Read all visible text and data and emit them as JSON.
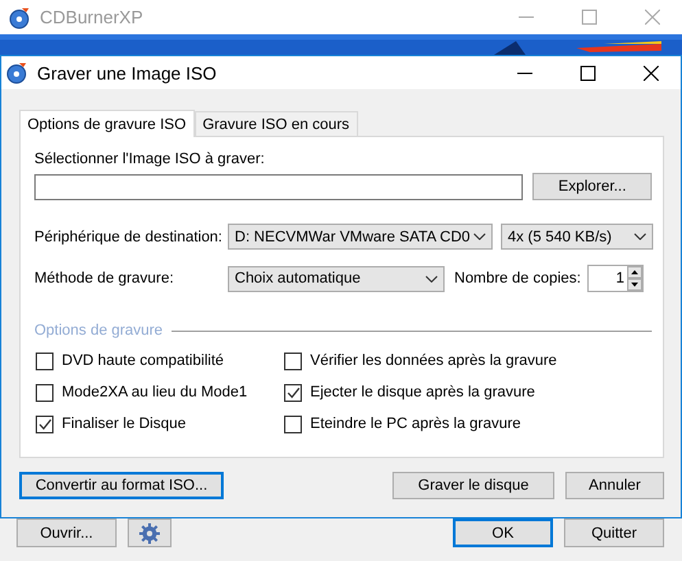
{
  "background_window": {
    "title": "CDBurnerXP",
    "buttons": [
      {
        "kind": "text",
        "label": "Ouvrir...",
        "default": false
      },
      {
        "kind": "settings"
      },
      {
        "kind": "text",
        "label": "OK",
        "default": true
      },
      {
        "kind": "text",
        "label": "Quitter",
        "default": false
      }
    ]
  },
  "dialog": {
    "title": "Graver une Image ISO",
    "tabs": [
      {
        "label": "Options de gravure ISO",
        "selected": true
      },
      {
        "label": "Gravure ISO en cours",
        "selected": false
      }
    ],
    "iso_field": {
      "label": "Sélectionner l'Image ISO à graver:"
    },
    "browse_button": "Explorer...",
    "destination": {
      "label": "Périphérique de destination:",
      "device": "D: NECVMWar VMware SATA CD0",
      "speed": "4x (5 540 KB/s)"
    },
    "method": {
      "label": "Méthode de gravure:",
      "value": "Choix automatique"
    },
    "copies": {
      "label": "Nombre de copies:",
      "value": "1"
    },
    "options": {
      "title": "Options de gravure",
      "items": [
        {
          "label": "DVD haute compatibilité",
          "checked": false
        },
        {
          "label": "Vérifier les données après la gravure",
          "checked": false
        },
        {
          "label": "Mode2XA au lieu du Mode1",
          "checked": false
        },
        {
          "label": "Ejecter le disque après la gravure",
          "checked": true
        },
        {
          "label": "Finaliser le Disque",
          "checked": true
        },
        {
          "label": "Eteindre le PC après la gravure",
          "checked": false
        }
      ]
    },
    "buttons": [
      {
        "label": "Convertir au format ISO...",
        "default": true
      },
      {
        "label": "Graver le disque",
        "default": false
      },
      {
        "label": "Annuler",
        "default": false
      }
    ]
  }
}
